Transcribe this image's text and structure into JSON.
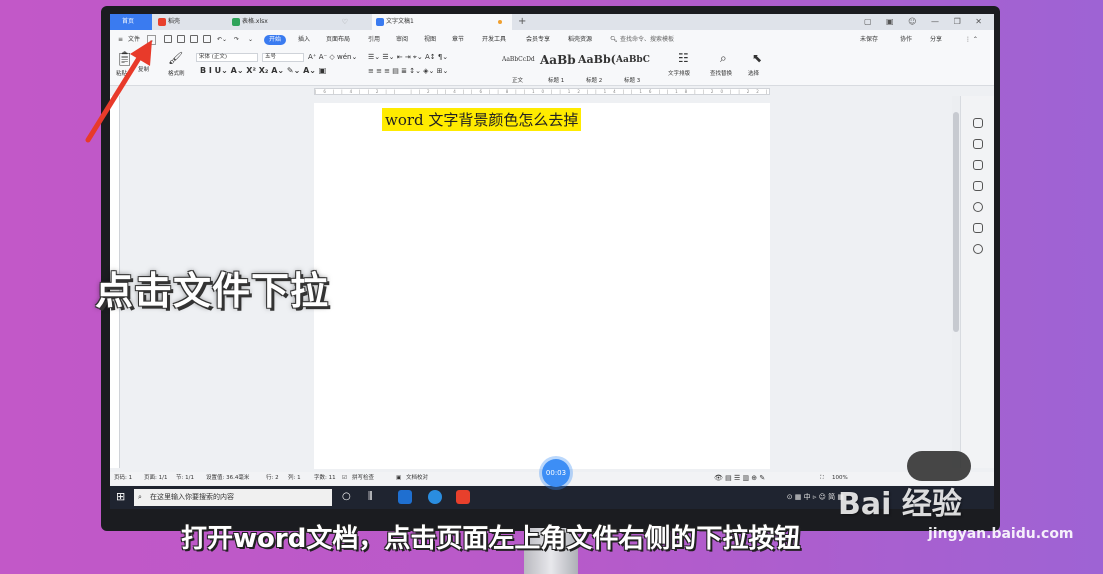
{
  "tabs": {
    "home": "首页",
    "daoke": "稻壳",
    "spreadsheet": "表格.xlsx",
    "document": "文字文稿1",
    "new_tab": "+"
  },
  "menu": {
    "file": "文件",
    "items": [
      "开始",
      "插入",
      "页面布局",
      "引用",
      "审阅",
      "视图",
      "章节",
      "开发工具",
      "会员专享",
      "稻壳资源"
    ],
    "search_placeholder": "查找命令、搜索模板",
    "unsaved": "未保存",
    "collab": "协作",
    "share": "分享"
  },
  "ribbon": {
    "paste": "粘贴",
    "cut": "剪切",
    "copy": "复制",
    "format_painter": "格式刷",
    "font_name": "宋体 (正文)",
    "font_size": "五号",
    "styles": [
      {
        "preview": "AaBbCcDd",
        "label": "正文"
      },
      {
        "preview": "AaBb",
        "label": "标题 1"
      },
      {
        "preview": "AaBb(",
        "label": "标题 2"
      },
      {
        "preview": "AaBbC",
        "label": "标题 3"
      }
    ],
    "text_layout": "文字排版",
    "find_replace": "查找替换",
    "select": "选择"
  },
  "document": {
    "text": "word 文字背景颜色怎么去掉",
    "highlight_color": "#ffeb00"
  },
  "statusbar": {
    "page_num": "页码: 1",
    "page": "页面: 1/1",
    "section": "节: 1/1",
    "setting": "设置值: 36.4毫米",
    "row": "行: 2",
    "col": "列: 1",
    "word_count": "字数: 11",
    "spell_check": "拼写检查",
    "doc_proof": "文档校对",
    "zoom": "100%"
  },
  "taskbar": {
    "search_placeholder": "在这里输入你要搜索的内容",
    "tray_text": "中",
    "tray_ime": "简"
  },
  "overlay": {
    "big_caption": "点击文件下拉",
    "subtitle": "打开word文档，点击页面左上角文件右侧的下拉按钮",
    "timer": "00:03",
    "watermark": "Bai 经验",
    "watermark_url": "jingyan.baidu.com"
  },
  "colors": {
    "accent": "#3a7bf0",
    "arrow": "#e83a2a"
  }
}
